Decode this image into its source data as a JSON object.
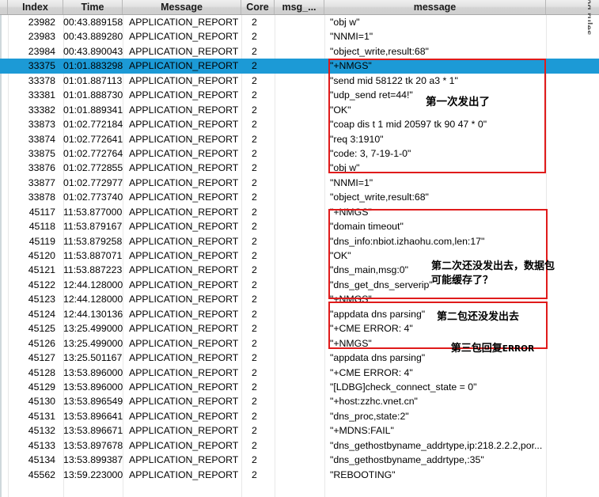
{
  "window": {
    "rotated_label": "Coloring rules"
  },
  "table": {
    "columns": [
      {
        "key": "index",
        "label": "Index"
      },
      {
        "key": "time",
        "label": "Time"
      },
      {
        "key": "message",
        "label": "Message"
      },
      {
        "key": "core",
        "label": "Core"
      },
      {
        "key": "msgn",
        "label": "msg_..."
      },
      {
        "key": "msgtext",
        "label": "message"
      },
      {
        "key": "tail",
        "label": ""
      }
    ],
    "selected_row_index": 3,
    "selection_color": "#1c9ad6",
    "rows": [
      {
        "index": "23982",
        "time": "00:43.889158",
        "message": "APPLICATION_REPORT",
        "core": "2",
        "msgn": "",
        "msgtext": "\"obj w\""
      },
      {
        "index": "23983",
        "time": "00:43.889280",
        "message": "APPLICATION_REPORT",
        "core": "2",
        "msgn": "",
        "msgtext": "\"NNMI=1\""
      },
      {
        "index": "23984",
        "time": "00:43.890043",
        "message": "APPLICATION_REPORT",
        "core": "2",
        "msgn": "",
        "msgtext": "\"object_write,result:68\""
      },
      {
        "index": "33375",
        "time": "01:01.883298",
        "message": "APPLICATION_REPORT",
        "core": "2",
        "msgn": "",
        "msgtext": "\"+NMGS\""
      },
      {
        "index": "33378",
        "time": "01:01.887113",
        "message": "APPLICATION_REPORT",
        "core": "2",
        "msgn": "",
        "msgtext": "\"send mid 58122 tk 20 a3 * 1\""
      },
      {
        "index": "33381",
        "time": "01:01.888730",
        "message": "APPLICATION_REPORT",
        "core": "2",
        "msgn": "",
        "msgtext": "\"udp_send ret=44!\""
      },
      {
        "index": "33382",
        "time": "01:01.889341",
        "message": "APPLICATION_REPORT",
        "core": "2",
        "msgn": "",
        "msgtext": "\"OK\""
      },
      {
        "index": "33873",
        "time": "01:02.772184",
        "message": "APPLICATION_REPORT",
        "core": "2",
        "msgn": "",
        "msgtext": "\"coap dis t 1 mid 20597 tk 90 47 * 0\""
      },
      {
        "index": "33874",
        "time": "01:02.772641",
        "message": "APPLICATION_REPORT",
        "core": "2",
        "msgn": "",
        "msgtext": "\"req 3:1910\""
      },
      {
        "index": "33875",
        "time": "01:02.772764",
        "message": "APPLICATION_REPORT",
        "core": "2",
        "msgn": "",
        "msgtext": "\"code: 3, 7-19-1-0\""
      },
      {
        "index": "33876",
        "time": "01:02.772855",
        "message": "APPLICATION_REPORT",
        "core": "2",
        "msgn": "",
        "msgtext": "\"obj w\""
      },
      {
        "index": "33877",
        "time": "01:02.772977",
        "message": "APPLICATION_REPORT",
        "core": "2",
        "msgn": "",
        "msgtext": "\"NNMI=1\""
      },
      {
        "index": "33878",
        "time": "01:02.773740",
        "message": "APPLICATION_REPORT",
        "core": "2",
        "msgn": "",
        "msgtext": "\"object_write,result:68\""
      },
      {
        "index": "45117",
        "time": "11:53.877000",
        "message": "APPLICATION_REPORT",
        "core": "2",
        "msgn": "",
        "msgtext": "\"+NMGS\""
      },
      {
        "index": "45118",
        "time": "11:53.879167",
        "message": "APPLICATION_REPORT",
        "core": "2",
        "msgn": "",
        "msgtext": "\"domain timeout\""
      },
      {
        "index": "45119",
        "time": "11:53.879258",
        "message": "APPLICATION_REPORT",
        "core": "2",
        "msgn": "",
        "msgtext": "\"dns_info:nbiot.izhaohu.com,len:17\""
      },
      {
        "index": "45120",
        "time": "11:53.887071",
        "message": "APPLICATION_REPORT",
        "core": "2",
        "msgn": "",
        "msgtext": "\"OK\""
      },
      {
        "index": "45121",
        "time": "11:53.887223",
        "message": "APPLICATION_REPORT",
        "core": "2",
        "msgn": "",
        "msgtext": "\"dns_main,msg:0\""
      },
      {
        "index": "45122",
        "time": "12:44.128000",
        "message": "APPLICATION_REPORT",
        "core": "2",
        "msgn": "",
        "msgtext": "\"dns_get_dns_serverip\""
      },
      {
        "index": "45123",
        "time": "12:44.128000",
        "message": "APPLICATION_REPORT",
        "core": "2",
        "msgn": "",
        "msgtext": "\"+NMGS\""
      },
      {
        "index": "45124",
        "time": "12:44.130136",
        "message": "APPLICATION_REPORT",
        "core": "2",
        "msgn": "",
        "msgtext": "\"appdata dns parsing\""
      },
      {
        "index": "45125",
        "time": "13:25.499000",
        "message": "APPLICATION_REPORT",
        "core": "2",
        "msgn": "",
        "msgtext": "\"+CME ERROR: 4\""
      },
      {
        "index": "45126",
        "time": "13:25.499000",
        "message": "APPLICATION_REPORT",
        "core": "2",
        "msgn": "",
        "msgtext": "\"+NMGS\""
      },
      {
        "index": "45127",
        "time": "13:25.501167",
        "message": "APPLICATION_REPORT",
        "core": "2",
        "msgn": "",
        "msgtext": "\"appdata dns parsing\""
      },
      {
        "index": "45128",
        "time": "13:53.896000",
        "message": "APPLICATION_REPORT",
        "core": "2",
        "msgn": "",
        "msgtext": "\"+CME ERROR: 4\""
      },
      {
        "index": "45129",
        "time": "13:53.896000",
        "message": "APPLICATION_REPORT",
        "core": "2",
        "msgn": "",
        "msgtext": "\"[LDBG]check_connect_state = 0\""
      },
      {
        "index": "45130",
        "time": "13:53.896549",
        "message": "APPLICATION_REPORT",
        "core": "2",
        "msgn": "",
        "msgtext": "\"+host:zzhc.vnet.cn\""
      },
      {
        "index": "45131",
        "time": "13:53.896641",
        "message": "APPLICATION_REPORT",
        "core": "2",
        "msgn": "",
        "msgtext": "\"dns_proc,state:2\""
      },
      {
        "index": "45132",
        "time": "13:53.896671",
        "message": "APPLICATION_REPORT",
        "core": "2",
        "msgn": "",
        "msgtext": "\"+MDNS:FAIL\""
      },
      {
        "index": "45133",
        "time": "13:53.897678",
        "message": "APPLICATION_REPORT",
        "core": "2",
        "msgn": "",
        "msgtext": "\"dns_gethostbyname_addrtype,ip:218.2.2.2,por..."
      },
      {
        "index": "45134",
        "time": "13:53.899387",
        "message": "APPLICATION_REPORT",
        "core": "2",
        "msgn": "",
        "msgtext": "\"dns_gethostbyname_addrtype,:35\""
      },
      {
        "index": "45562",
        "time": "13:59.223000",
        "message": "APPLICATION_REPORT",
        "core": "2",
        "msgn": "",
        "msgtext": "\"REBOOTING\""
      }
    ]
  },
  "annotations": {
    "box_color": "#e01b1b",
    "items": [
      {
        "id": "note-1",
        "text": "第一次发出了"
      },
      {
        "id": "note-2",
        "line1": "第二次还没发出去，数据包",
        "line2": "可能缓存了？"
      },
      {
        "id": "note-3",
        "line1": "第二包还没发出去",
        "line2_cn": "第三包回复",
        "line2_en": "ERROR"
      }
    ]
  }
}
